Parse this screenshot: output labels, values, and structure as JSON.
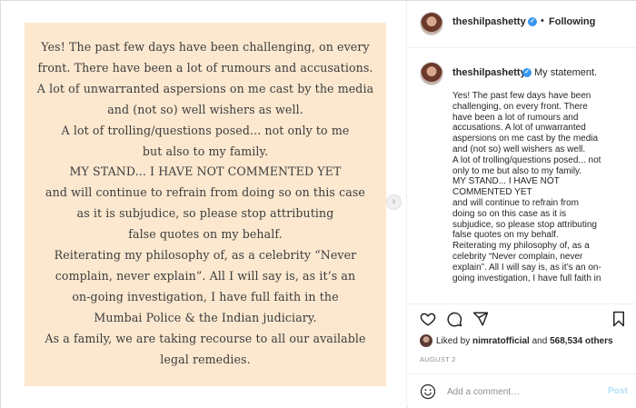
{
  "image_card": {
    "lines": [
      "Yes! The past few days have been challenging, on every",
      "front. There have been a lot of rumours and accusations.",
      "A lot of unwarranted aspersions on me cast by the media",
      "and (not so) well wishers as well.",
      "A lot of trolling/questions posed... not only to me",
      "but also to my family.",
      "MY STAND... I HAVE NOT COMMENTED YET",
      "and will continue to refrain from doing so on this case",
      "as it is subjudice, so please stop attributing",
      "false quotes on my behalf.",
      "Reiterating my philosophy of, as a celebrity “Never",
      "complain, never explain”. All I will say is, as it’s an",
      "on-going investigation, I have full faith in the",
      "Mumbai Police & the Indian judiciary.",
      "As a family, we are taking recourse to all our available",
      "legal remedies."
    ],
    "background": "#fbe8cf",
    "next_glyph": "›"
  },
  "header": {
    "username": "theshilpashetty",
    "verified_glyph": "✓",
    "separator": "•",
    "follow_status": "Following"
  },
  "caption": {
    "username": "theshilpashetty",
    "verified_glyph": "✓",
    "headline": "My statement.",
    "lines": [
      "Yes! The past few days have been",
      "challenging, on every front. There",
      "have been a lot of rumours and",
      "accusations. A lot of unwarranted",
      "aspersions on me cast by the media",
      "and (not so) well wishers as well.",
      "A lot of trolling/questions posed... not",
      "only to me but also to my family.",
      "MY STAND... I HAVE NOT",
      "COMMENTED YET",
      "and will continue to refrain from",
      "doing so on this case as it is",
      "subjudice, so please stop attributing",
      "false quotes on my behalf.",
      "Reiterating my philosophy of, as a",
      "celebrity “Never complain, never",
      "explain”. All I will say is, as it’s an on-",
      "going investigation, I have full faith in"
    ]
  },
  "actions": {
    "icons": [
      "heart-icon",
      "comment-icon",
      "share-icon",
      "bookmark-icon"
    ]
  },
  "likes": {
    "prefix": "Liked by ",
    "user": "nimratofficial",
    "middle": " and ",
    "count": "568,534 others"
  },
  "date": "AUGUST 2",
  "comment": {
    "placeholder": "Add a comment…",
    "post_label": "Post"
  },
  "colors": {
    "verified": "#3897f0",
    "post_disabled": "#b2dffc",
    "muted": "#8e8e8e"
  }
}
